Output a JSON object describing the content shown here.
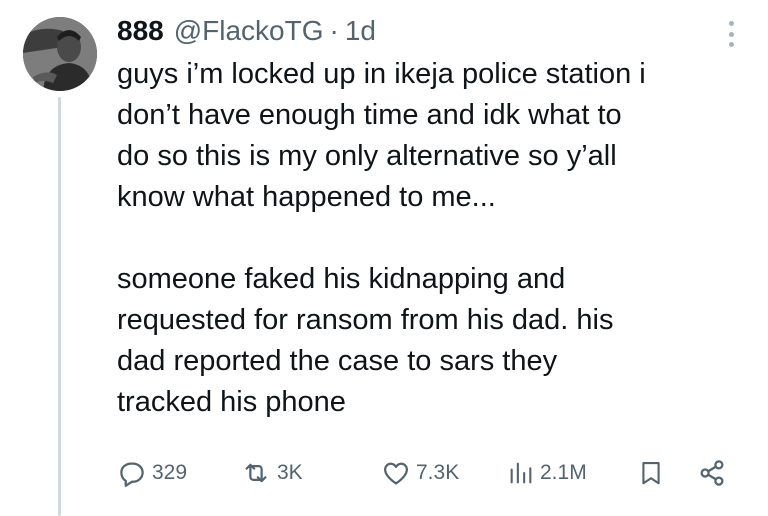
{
  "author": {
    "display_name": "888",
    "handle": "@FlackoTG",
    "separator": "·",
    "time": "1d"
  },
  "tweet": {
    "paragraphs": [
      "guys i’m locked up in ikeja police station i\ndon’t have enough time and idk what to\ndo so this is my only alternative so y’all\nknow what happened to me...",
      "someone faked his kidnapping and\nrequested for ransom from his dad. his\ndad reported the case to sars they\ntracked his phone"
    ]
  },
  "actions": {
    "replies": "329",
    "retweets": "3K",
    "likes": "7.3K",
    "views": "2.1M"
  },
  "icons": {
    "reply": "reply-icon",
    "retweet": "retweet-icon",
    "like": "heart-icon",
    "views": "views-icon",
    "bookmark": "bookmark-icon",
    "share": "share-icon",
    "more": "more-vertical-icon"
  },
  "colors": {
    "text": "#0f1419",
    "secondary": "#536471",
    "thread_line": "#cfd9de"
  }
}
